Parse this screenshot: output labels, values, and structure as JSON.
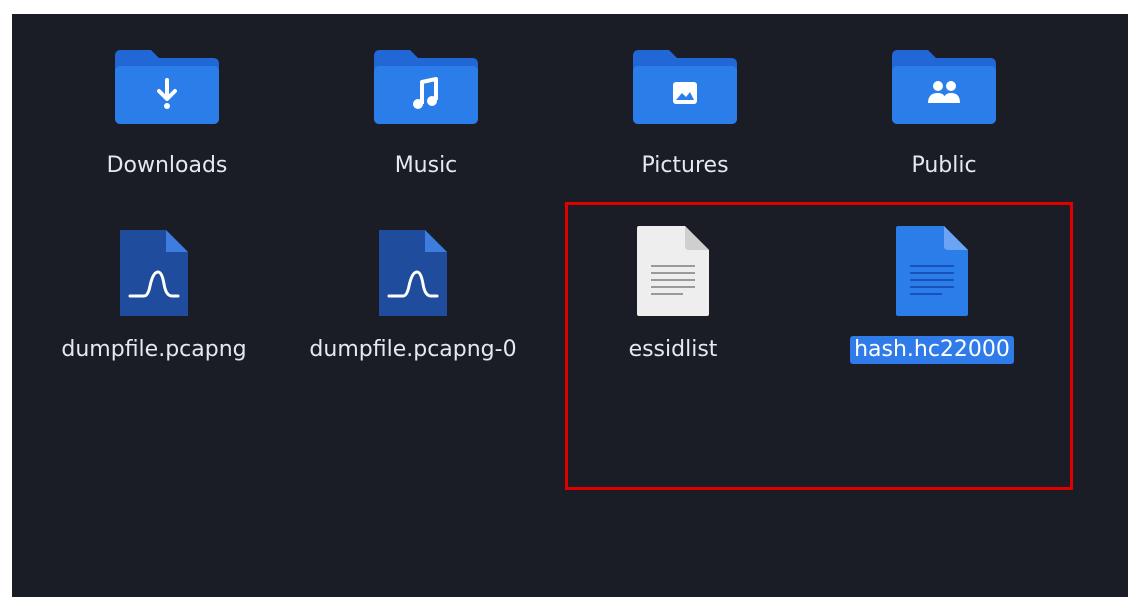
{
  "files": [
    {
      "name": "Downloads",
      "icon": "folder-download-icon",
      "selected": false
    },
    {
      "name": "Music",
      "icon": "folder-music-icon",
      "selected": false
    },
    {
      "name": "Pictures",
      "icon": "folder-pictures-icon",
      "selected": false
    },
    {
      "name": "Public",
      "icon": "folder-public-icon",
      "selected": false
    },
    {
      "name": "dumpfile.pcapng",
      "icon": "pcap-file-icon",
      "selected": false
    },
    {
      "name": "dumpfile.pcapng-0",
      "icon": "pcap-file-icon",
      "selected": false
    },
    {
      "name": "essidlist",
      "icon": "text-file-icon",
      "selected": false
    },
    {
      "name": "hash.hc22000",
      "icon": "text-file-blue-icon",
      "selected": true
    }
  ],
  "colors": {
    "background": "#1b1d26",
    "folder": "#2b7de9",
    "selection": "#2f7be9",
    "annotation_box": "#e00000"
  }
}
